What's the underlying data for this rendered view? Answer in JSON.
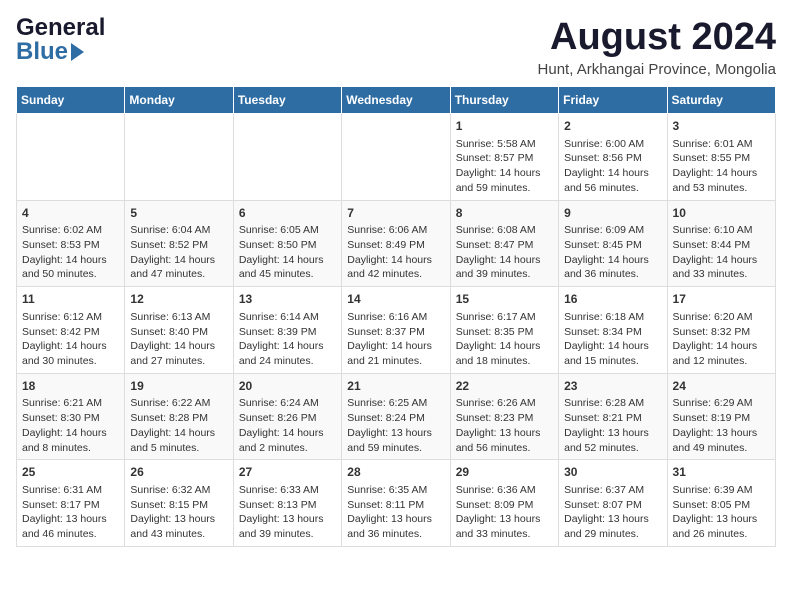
{
  "header": {
    "logo_line1": "General",
    "logo_line2": "Blue",
    "title": "August 2024",
    "subtitle": "Hunt, Arkhangai Province, Mongolia"
  },
  "days_of_week": [
    "Sunday",
    "Monday",
    "Tuesday",
    "Wednesday",
    "Thursday",
    "Friday",
    "Saturday"
  ],
  "weeks": [
    [
      {
        "day": "",
        "info": ""
      },
      {
        "day": "",
        "info": ""
      },
      {
        "day": "",
        "info": ""
      },
      {
        "day": "",
        "info": ""
      },
      {
        "day": "1",
        "info": "Sunrise: 5:58 AM\nSunset: 8:57 PM\nDaylight: 14 hours\nand 59 minutes."
      },
      {
        "day": "2",
        "info": "Sunrise: 6:00 AM\nSunset: 8:56 PM\nDaylight: 14 hours\nand 56 minutes."
      },
      {
        "day": "3",
        "info": "Sunrise: 6:01 AM\nSunset: 8:55 PM\nDaylight: 14 hours\nand 53 minutes."
      }
    ],
    [
      {
        "day": "4",
        "info": "Sunrise: 6:02 AM\nSunset: 8:53 PM\nDaylight: 14 hours\nand 50 minutes."
      },
      {
        "day": "5",
        "info": "Sunrise: 6:04 AM\nSunset: 8:52 PM\nDaylight: 14 hours\nand 47 minutes."
      },
      {
        "day": "6",
        "info": "Sunrise: 6:05 AM\nSunset: 8:50 PM\nDaylight: 14 hours\nand 45 minutes."
      },
      {
        "day": "7",
        "info": "Sunrise: 6:06 AM\nSunset: 8:49 PM\nDaylight: 14 hours\nand 42 minutes."
      },
      {
        "day": "8",
        "info": "Sunrise: 6:08 AM\nSunset: 8:47 PM\nDaylight: 14 hours\nand 39 minutes."
      },
      {
        "day": "9",
        "info": "Sunrise: 6:09 AM\nSunset: 8:45 PM\nDaylight: 14 hours\nand 36 minutes."
      },
      {
        "day": "10",
        "info": "Sunrise: 6:10 AM\nSunset: 8:44 PM\nDaylight: 14 hours\nand 33 minutes."
      }
    ],
    [
      {
        "day": "11",
        "info": "Sunrise: 6:12 AM\nSunset: 8:42 PM\nDaylight: 14 hours\nand 30 minutes."
      },
      {
        "day": "12",
        "info": "Sunrise: 6:13 AM\nSunset: 8:40 PM\nDaylight: 14 hours\nand 27 minutes."
      },
      {
        "day": "13",
        "info": "Sunrise: 6:14 AM\nSunset: 8:39 PM\nDaylight: 14 hours\nand 24 minutes."
      },
      {
        "day": "14",
        "info": "Sunrise: 6:16 AM\nSunset: 8:37 PM\nDaylight: 14 hours\nand 21 minutes."
      },
      {
        "day": "15",
        "info": "Sunrise: 6:17 AM\nSunset: 8:35 PM\nDaylight: 14 hours\nand 18 minutes."
      },
      {
        "day": "16",
        "info": "Sunrise: 6:18 AM\nSunset: 8:34 PM\nDaylight: 14 hours\nand 15 minutes."
      },
      {
        "day": "17",
        "info": "Sunrise: 6:20 AM\nSunset: 8:32 PM\nDaylight: 14 hours\nand 12 minutes."
      }
    ],
    [
      {
        "day": "18",
        "info": "Sunrise: 6:21 AM\nSunset: 8:30 PM\nDaylight: 14 hours\nand 8 minutes."
      },
      {
        "day": "19",
        "info": "Sunrise: 6:22 AM\nSunset: 8:28 PM\nDaylight: 14 hours\nand 5 minutes."
      },
      {
        "day": "20",
        "info": "Sunrise: 6:24 AM\nSunset: 8:26 PM\nDaylight: 14 hours\nand 2 minutes."
      },
      {
        "day": "21",
        "info": "Sunrise: 6:25 AM\nSunset: 8:24 PM\nDaylight: 13 hours\nand 59 minutes."
      },
      {
        "day": "22",
        "info": "Sunrise: 6:26 AM\nSunset: 8:23 PM\nDaylight: 13 hours\nand 56 minutes."
      },
      {
        "day": "23",
        "info": "Sunrise: 6:28 AM\nSunset: 8:21 PM\nDaylight: 13 hours\nand 52 minutes."
      },
      {
        "day": "24",
        "info": "Sunrise: 6:29 AM\nSunset: 8:19 PM\nDaylight: 13 hours\nand 49 minutes."
      }
    ],
    [
      {
        "day": "25",
        "info": "Sunrise: 6:31 AM\nSunset: 8:17 PM\nDaylight: 13 hours\nand 46 minutes."
      },
      {
        "day": "26",
        "info": "Sunrise: 6:32 AM\nSunset: 8:15 PM\nDaylight: 13 hours\nand 43 minutes."
      },
      {
        "day": "27",
        "info": "Sunrise: 6:33 AM\nSunset: 8:13 PM\nDaylight: 13 hours\nand 39 minutes."
      },
      {
        "day": "28",
        "info": "Sunrise: 6:35 AM\nSunset: 8:11 PM\nDaylight: 13 hours\nand 36 minutes."
      },
      {
        "day": "29",
        "info": "Sunrise: 6:36 AM\nSunset: 8:09 PM\nDaylight: 13 hours\nand 33 minutes."
      },
      {
        "day": "30",
        "info": "Sunrise: 6:37 AM\nSunset: 8:07 PM\nDaylight: 13 hours\nand 29 minutes."
      },
      {
        "day": "31",
        "info": "Sunrise: 6:39 AM\nSunset: 8:05 PM\nDaylight: 13 hours\nand 26 minutes."
      }
    ]
  ]
}
